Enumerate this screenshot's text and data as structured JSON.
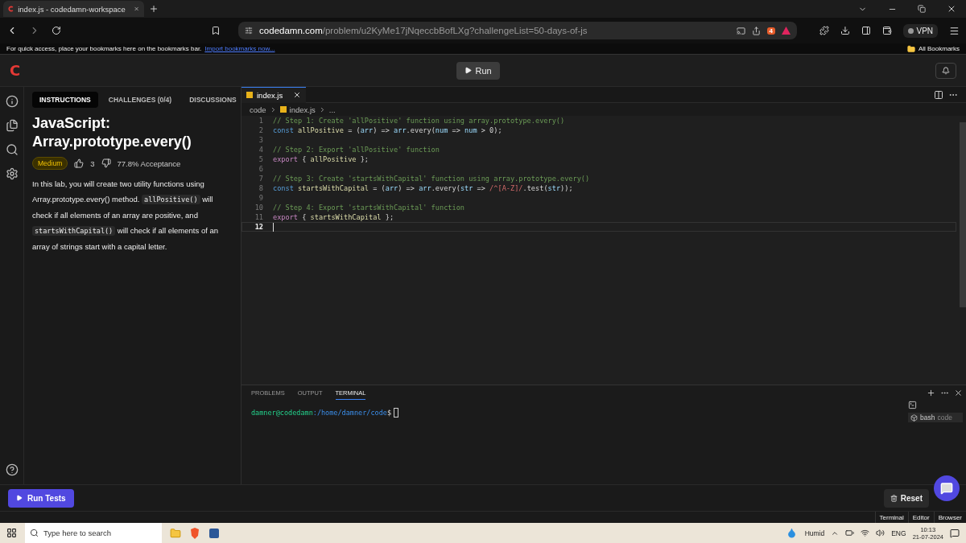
{
  "browser": {
    "tab_title": "index.js - codedamn-workspace",
    "url_host": "codedamn.com",
    "url_path": "/problem/u2KyMe17jNqeccbBofLXg?challengeList=50-days-of-js",
    "vpn": "VPN",
    "bookmarks_hint": "For quick access, place your bookmarks here on the bookmarks bar.",
    "bookmarks_link": "Import bookmarks now...",
    "all_bookmarks": "All Bookmarks",
    "shield_count": "4"
  },
  "header": {
    "logo": "C",
    "run": "Run"
  },
  "panel_tabs": [
    {
      "label": "INSTRUCTIONS",
      "selected": true
    },
    {
      "label": "CHALLENGES (0/4)",
      "selected": false
    },
    {
      "label": "DISCUSSIONS",
      "selected": false
    }
  ],
  "problem": {
    "title": "JavaScript: Array.prototype.every()",
    "difficulty": "Medium",
    "likes": "3",
    "acceptance": "77.8% Acceptance",
    "description": [
      {
        "text": "In this lab, you will create two utility functions using Array.prototype.every() method. ",
        "kind": "text"
      },
      {
        "text": "allPositive()",
        "kind": "code"
      },
      {
        "text": " will check if all elements of an array are positive, and ",
        "kind": "text"
      },
      {
        "text": "startsWithCapital()",
        "kind": "code"
      },
      {
        "text": " will check if all elements of an array of strings start with a capital letter.",
        "kind": "text"
      }
    ]
  },
  "editor": {
    "file_tab": "index.js",
    "breadcrumb": [
      "code",
      "index.js",
      "..."
    ],
    "lines": [
      {
        "num": "1",
        "current": false,
        "tokens": [
          {
            "t": "// Step 1: Create 'allPositive' function using array.prototype.every()",
            "kind": "comment"
          }
        ]
      },
      {
        "num": "2",
        "current": false,
        "tokens": [
          {
            "t": "const ",
            "kind": "kw"
          },
          {
            "t": "allPositive",
            "kind": "var"
          },
          {
            "t": " = (",
            "kind": "punct"
          },
          {
            "t": "arr",
            "kind": "param"
          },
          {
            "t": ") => ",
            "kind": "punct"
          },
          {
            "t": "arr",
            "kind": "param"
          },
          {
            "t": ".every(",
            "kind": "punct"
          },
          {
            "t": "num",
            "kind": "param"
          },
          {
            "t": " => ",
            "kind": "punct"
          },
          {
            "t": "num",
            "kind": "param"
          },
          {
            "t": " > 0);",
            "kind": "punct"
          }
        ]
      },
      {
        "num": "3",
        "current": false
      },
      {
        "num": "4",
        "current": false,
        "tokens": [
          {
            "t": "// Step 2: Export 'allPositive' function",
            "kind": "comment"
          }
        ]
      },
      {
        "num": "5",
        "current": false,
        "tokens": [
          {
            "t": "export",
            "kind": "kw2"
          },
          {
            "t": " { ",
            "kind": "punct"
          },
          {
            "t": "allPositive",
            "kind": "var"
          },
          {
            "t": " };",
            "kind": "punct"
          }
        ]
      },
      {
        "num": "6",
        "current": false
      },
      {
        "num": "7",
        "current": false,
        "tokens": [
          {
            "t": "// Step 3: Create 'startsWithCapital' function using array.prototype.every()",
            "kind": "comment"
          }
        ]
      },
      {
        "num": "8",
        "current": false,
        "tokens": [
          {
            "t": "const ",
            "kind": "kw"
          },
          {
            "t": "startsWithCapital",
            "kind": "var"
          },
          {
            "t": " = (",
            "kind": "punct"
          },
          {
            "t": "arr",
            "kind": "param"
          },
          {
            "t": ") => ",
            "kind": "punct"
          },
          {
            "t": "arr",
            "kind": "param"
          },
          {
            "t": ".every(",
            "kind": "punct"
          },
          {
            "t": "str",
            "kind": "param"
          },
          {
            "t": " => ",
            "kind": "punct"
          },
          {
            "t": "/^[A-Z]/",
            "kind": "regex"
          },
          {
            "t": ".test(",
            "kind": "punct"
          },
          {
            "t": "str",
            "kind": "param"
          },
          {
            "t": "));",
            "kind": "punct"
          }
        ]
      },
      {
        "num": "9",
        "current": false
      },
      {
        "num": "10",
        "current": false,
        "tokens": [
          {
            "t": "// Step 4: Export 'startsWithCapital' function",
            "kind": "comment"
          }
        ]
      },
      {
        "num": "11",
        "current": false,
        "tokens": [
          {
            "t": "export",
            "kind": "kw2"
          },
          {
            "t": " { ",
            "kind": "punct"
          },
          {
            "t": "startsWithCapital",
            "kind": "var"
          },
          {
            "t": " };",
            "kind": "punct"
          }
        ]
      },
      {
        "num": "12",
        "current": true
      }
    ]
  },
  "terminal": {
    "tabs": [
      {
        "label": "PROBLEMS",
        "selected": false
      },
      {
        "label": "OUTPUT",
        "selected": false
      },
      {
        "label": "TERMINAL",
        "selected": true
      }
    ],
    "user": "damner@codedamn",
    "path": ":/home/damner/code",
    "prompt": "$",
    "shell": "bash",
    "shell_dir": "code"
  },
  "footer": {
    "run_tests": "Run Tests",
    "reset": "Reset"
  },
  "view_tabs": [
    "Terminal",
    "Editor",
    "Browser"
  ],
  "taskbar": {
    "search_placeholder": "Type here to search",
    "weather": "Humid",
    "lang": "ENG",
    "time": "10:13",
    "date": "21-07-2024"
  }
}
